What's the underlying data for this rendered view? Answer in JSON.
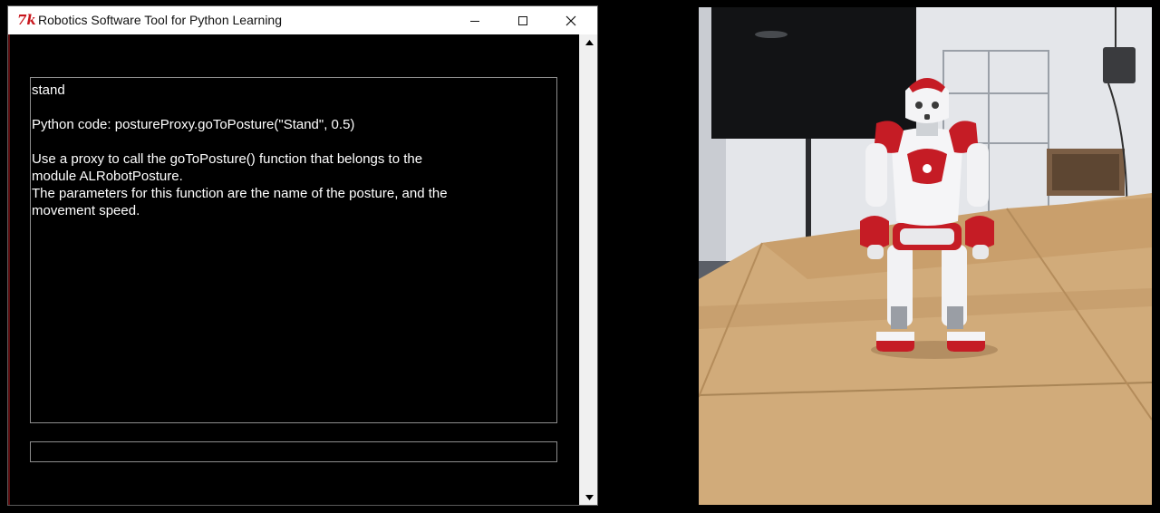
{
  "window": {
    "title": "Robotics Software Tool for Python Learning",
    "icon": "tk-feather-icon",
    "buttons": {
      "minimize": "minimize-icon",
      "maximize": "maximize-icon",
      "close": "close-icon"
    }
  },
  "output": {
    "command": "stand",
    "code_line": "Python code: postureProxy.goToPosture(\"Stand\", 0.5)",
    "description_1": "Use a proxy to call the goToPosture() function that belongs to the\nmodule ALRobotPosture.",
    "description_2": "The parameters for this function are the name of the posture, and the\nmovement speed."
  },
  "input": {
    "value": ""
  },
  "camera": {
    "subject": "robot-camera-feed"
  },
  "colors": {
    "background": "#000000",
    "text": "#ffffff",
    "tk_icon": "#c8161d",
    "robot_accent": "#c51c25"
  }
}
